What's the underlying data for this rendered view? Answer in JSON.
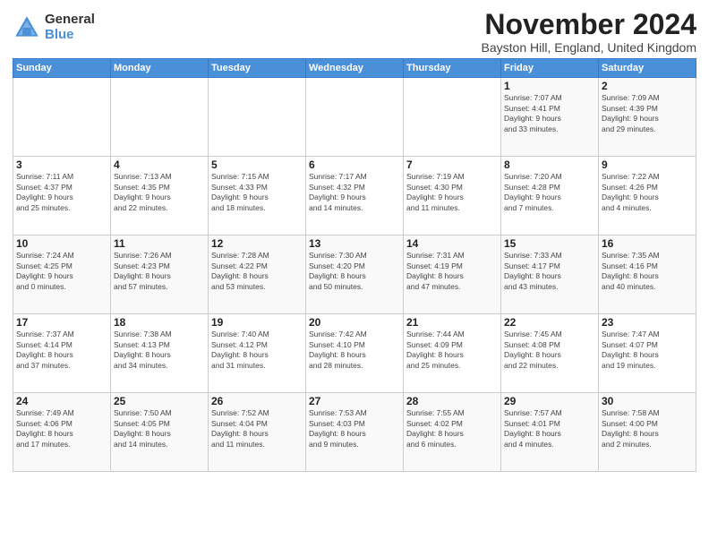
{
  "logo": {
    "general": "General",
    "blue": "Blue"
  },
  "title": "November 2024",
  "location": "Bayston Hill, England, United Kingdom",
  "days_of_week": [
    "Sunday",
    "Monday",
    "Tuesday",
    "Wednesday",
    "Thursday",
    "Friday",
    "Saturday"
  ],
  "weeks": [
    [
      {
        "day": "",
        "info": ""
      },
      {
        "day": "",
        "info": ""
      },
      {
        "day": "",
        "info": ""
      },
      {
        "day": "",
        "info": ""
      },
      {
        "day": "",
        "info": ""
      },
      {
        "day": "1",
        "info": "Sunrise: 7:07 AM\nSunset: 4:41 PM\nDaylight: 9 hours\nand 33 minutes."
      },
      {
        "day": "2",
        "info": "Sunrise: 7:09 AM\nSunset: 4:39 PM\nDaylight: 9 hours\nand 29 minutes."
      }
    ],
    [
      {
        "day": "3",
        "info": "Sunrise: 7:11 AM\nSunset: 4:37 PM\nDaylight: 9 hours\nand 25 minutes."
      },
      {
        "day": "4",
        "info": "Sunrise: 7:13 AM\nSunset: 4:35 PM\nDaylight: 9 hours\nand 22 minutes."
      },
      {
        "day": "5",
        "info": "Sunrise: 7:15 AM\nSunset: 4:33 PM\nDaylight: 9 hours\nand 18 minutes."
      },
      {
        "day": "6",
        "info": "Sunrise: 7:17 AM\nSunset: 4:32 PM\nDaylight: 9 hours\nand 14 minutes."
      },
      {
        "day": "7",
        "info": "Sunrise: 7:19 AM\nSunset: 4:30 PM\nDaylight: 9 hours\nand 11 minutes."
      },
      {
        "day": "8",
        "info": "Sunrise: 7:20 AM\nSunset: 4:28 PM\nDaylight: 9 hours\nand 7 minutes."
      },
      {
        "day": "9",
        "info": "Sunrise: 7:22 AM\nSunset: 4:26 PM\nDaylight: 9 hours\nand 4 minutes."
      }
    ],
    [
      {
        "day": "10",
        "info": "Sunrise: 7:24 AM\nSunset: 4:25 PM\nDaylight: 9 hours\nand 0 minutes."
      },
      {
        "day": "11",
        "info": "Sunrise: 7:26 AM\nSunset: 4:23 PM\nDaylight: 8 hours\nand 57 minutes."
      },
      {
        "day": "12",
        "info": "Sunrise: 7:28 AM\nSunset: 4:22 PM\nDaylight: 8 hours\nand 53 minutes."
      },
      {
        "day": "13",
        "info": "Sunrise: 7:30 AM\nSunset: 4:20 PM\nDaylight: 8 hours\nand 50 minutes."
      },
      {
        "day": "14",
        "info": "Sunrise: 7:31 AM\nSunset: 4:19 PM\nDaylight: 8 hours\nand 47 minutes."
      },
      {
        "day": "15",
        "info": "Sunrise: 7:33 AM\nSunset: 4:17 PM\nDaylight: 8 hours\nand 43 minutes."
      },
      {
        "day": "16",
        "info": "Sunrise: 7:35 AM\nSunset: 4:16 PM\nDaylight: 8 hours\nand 40 minutes."
      }
    ],
    [
      {
        "day": "17",
        "info": "Sunrise: 7:37 AM\nSunset: 4:14 PM\nDaylight: 8 hours\nand 37 minutes."
      },
      {
        "day": "18",
        "info": "Sunrise: 7:38 AM\nSunset: 4:13 PM\nDaylight: 8 hours\nand 34 minutes."
      },
      {
        "day": "19",
        "info": "Sunrise: 7:40 AM\nSunset: 4:12 PM\nDaylight: 8 hours\nand 31 minutes."
      },
      {
        "day": "20",
        "info": "Sunrise: 7:42 AM\nSunset: 4:10 PM\nDaylight: 8 hours\nand 28 minutes."
      },
      {
        "day": "21",
        "info": "Sunrise: 7:44 AM\nSunset: 4:09 PM\nDaylight: 8 hours\nand 25 minutes."
      },
      {
        "day": "22",
        "info": "Sunrise: 7:45 AM\nSunset: 4:08 PM\nDaylight: 8 hours\nand 22 minutes."
      },
      {
        "day": "23",
        "info": "Sunrise: 7:47 AM\nSunset: 4:07 PM\nDaylight: 8 hours\nand 19 minutes."
      }
    ],
    [
      {
        "day": "24",
        "info": "Sunrise: 7:49 AM\nSunset: 4:06 PM\nDaylight: 8 hours\nand 17 minutes."
      },
      {
        "day": "25",
        "info": "Sunrise: 7:50 AM\nSunset: 4:05 PM\nDaylight: 8 hours\nand 14 minutes."
      },
      {
        "day": "26",
        "info": "Sunrise: 7:52 AM\nSunset: 4:04 PM\nDaylight: 8 hours\nand 11 minutes."
      },
      {
        "day": "27",
        "info": "Sunrise: 7:53 AM\nSunset: 4:03 PM\nDaylight: 8 hours\nand 9 minutes."
      },
      {
        "day": "28",
        "info": "Sunrise: 7:55 AM\nSunset: 4:02 PM\nDaylight: 8 hours\nand 6 minutes."
      },
      {
        "day": "29",
        "info": "Sunrise: 7:57 AM\nSunset: 4:01 PM\nDaylight: 8 hours\nand 4 minutes."
      },
      {
        "day": "30",
        "info": "Sunrise: 7:58 AM\nSunset: 4:00 PM\nDaylight: 8 hours\nand 2 minutes."
      }
    ]
  ]
}
